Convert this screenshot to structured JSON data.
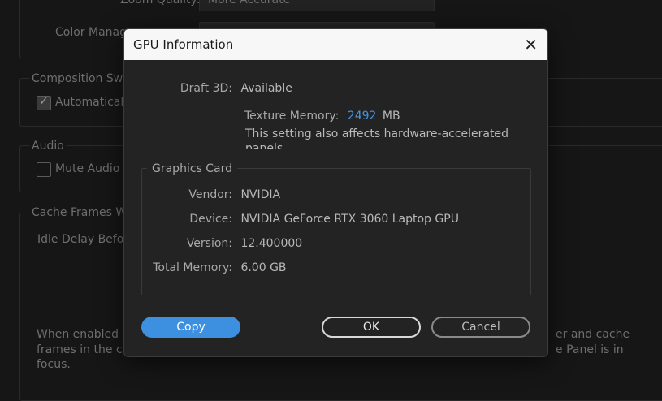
{
  "background": {
    "zoom_quality_label": "Zoom Quality:",
    "zoom_quality_value": "More Accurate",
    "color_manage_label": "Color Manage",
    "composition_switch_title": "Composition Switc",
    "automatically_label": "Automatically",
    "audio_title": "Audio",
    "mute_audio_label": "Mute Audio W",
    "cache_frames_title": "Cache Frames Whe",
    "idle_delay_label": "Idle Delay Before",
    "bottom_left_line1": "When enabled in",
    "bottom_left_line2": "frames in the cur",
    "bottom_left_line3": "focus.",
    "bottom_right_line1": "er and cache",
    "bottom_right_line2": "e Panel is in"
  },
  "dialog": {
    "title": "GPU Information",
    "draft3d_label": "Draft 3D:",
    "draft3d_value": "Available",
    "texture_memory_label": "Texture Memory:",
    "texture_memory_value": "2492",
    "texture_memory_unit": "MB",
    "note_line1": "This setting also affects hardware-accelerated",
    "note_line2": "panels.",
    "graphics_card": {
      "title": "Graphics Card",
      "vendor_label": "Vendor:",
      "vendor_value": "NVIDIA",
      "device_label": "Device:",
      "device_value": "NVIDIA GeForce RTX 3060 Laptop GPU",
      "version_label": "Version:",
      "version_value": "12.400000",
      "total_memory_label": "Total Memory:",
      "total_memory_value": "6.00 GB"
    },
    "buttons": {
      "copy": "Copy",
      "ok": "OK",
      "cancel": "Cancel"
    }
  }
}
